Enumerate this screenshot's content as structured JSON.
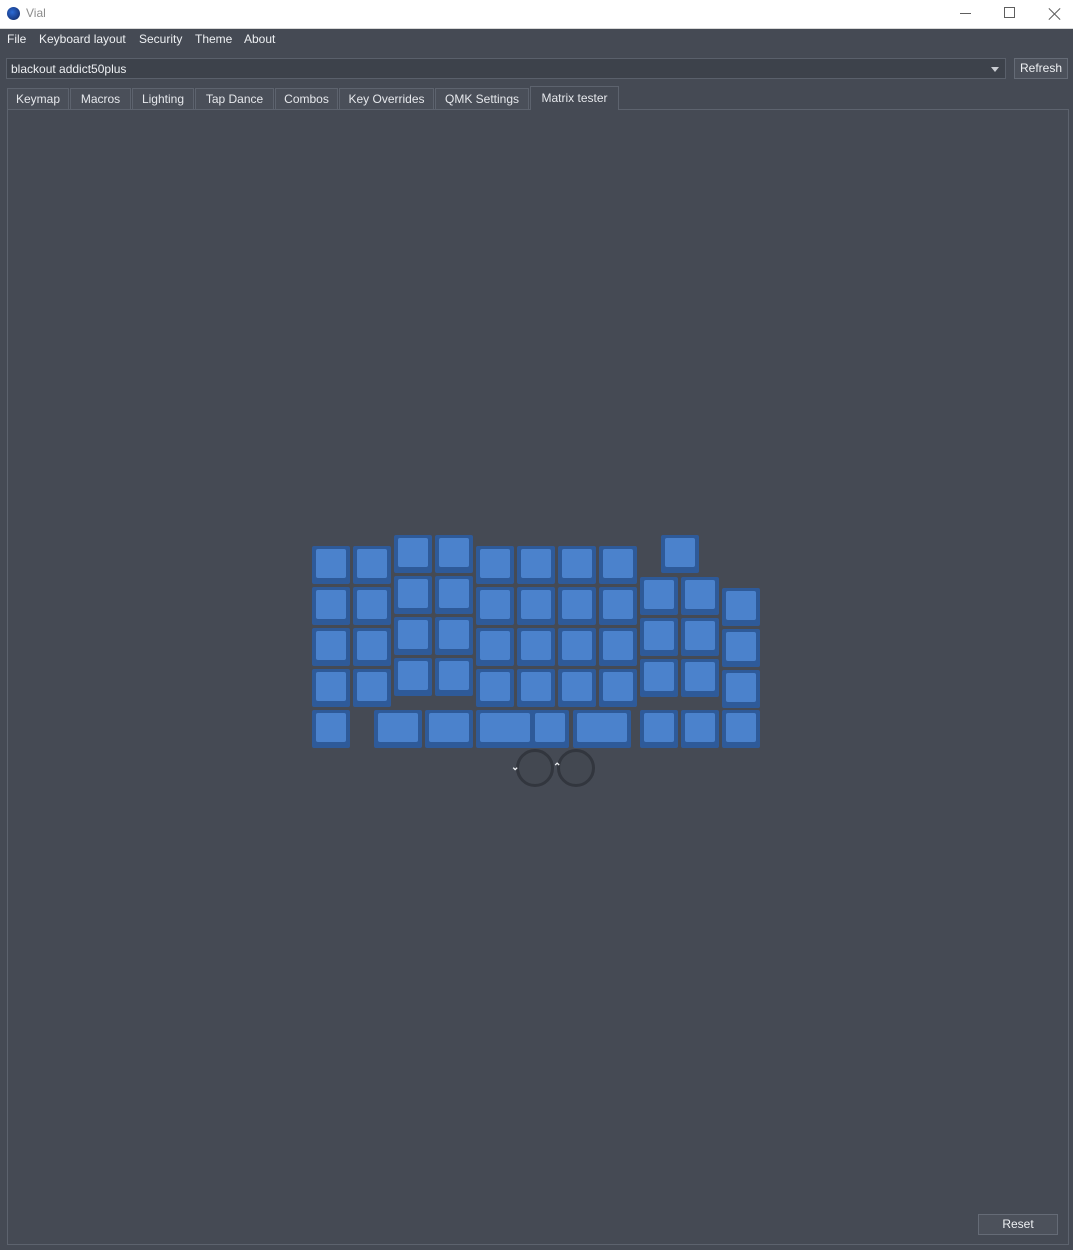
{
  "window": {
    "title": "Vial"
  },
  "menu": [
    "File",
    "Keyboard layout",
    "Security",
    "Theme",
    "About"
  ],
  "device": {
    "selected": "blackout addict50plus"
  },
  "toolbar": {
    "refresh_label": "Refresh"
  },
  "tabs": [
    {
      "label": "Keymap",
      "active": false
    },
    {
      "label": "Macros",
      "active": false
    },
    {
      "label": "Lighting",
      "active": false
    },
    {
      "label": "Tap Dance",
      "active": false
    },
    {
      "label": "Combos",
      "active": false
    },
    {
      "label": "Key Overrides",
      "active": false
    },
    {
      "label": "QMK Settings",
      "active": false
    },
    {
      "label": "Matrix tester",
      "active": true
    }
  ],
  "matrix": {
    "key_color": "#4b82cc",
    "key_border_color": "#2e5a99",
    "key_count": 50,
    "encoders": 2
  },
  "encoders": {
    "ccw_icon": "chevron-down-icon",
    "cw_icon": "chevron-up-icon"
  },
  "footer": {
    "reset_label": "Reset"
  }
}
